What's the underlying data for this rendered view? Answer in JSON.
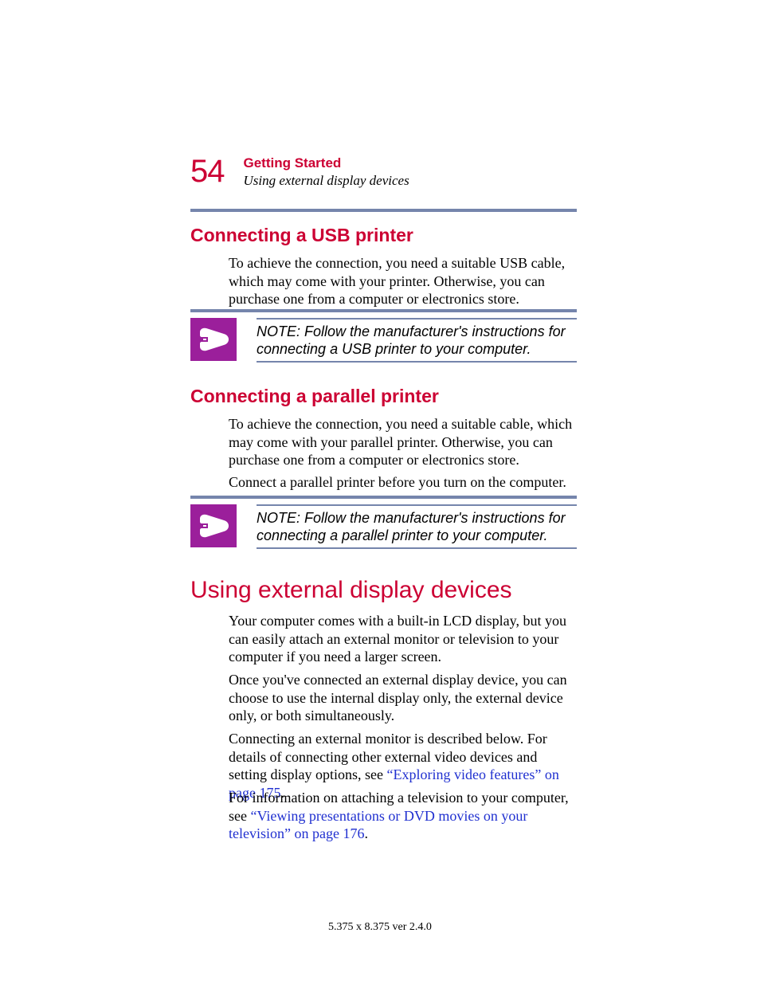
{
  "header": {
    "page_number": "54",
    "chapter": "Getting Started",
    "section": "Using external display devices"
  },
  "sections": {
    "usb": {
      "heading": "Connecting a USB printer",
      "body": "To achieve the connection, you need a suitable USB cable, which may come with your printer. Otherwise, you can purchase one from a computer or electronics store.",
      "note": "NOTE: Follow the manufacturer's instructions for connecting a USB printer to your computer."
    },
    "parallel": {
      "heading": "Connecting a parallel printer",
      "body1": "To achieve the connection, you need a suitable cable, which may come with your parallel printer. Otherwise, you can purchase one from a computer or electronics store.",
      "body2": "Connect a parallel printer before you turn on the computer.",
      "note": "NOTE: Follow the manufacturer's instructions for connecting a parallel printer to your computer."
    },
    "display": {
      "heading": "Using external display devices",
      "p1": "Your computer comes with a built-in LCD display, but you can easily attach an external monitor or television to your computer if you need a larger screen.",
      "p2": "Once you've connected an external display device, you can choose to use the internal display only, the external device only, or both simultaneously.",
      "p3_pre": "Connecting an external monitor is described below. For details of connecting other external video devices and setting display options, see ",
      "p3_link": "“Exploring video features” on page 175",
      "p3_post": ".",
      "p4_pre": "For information on attaching a television to your computer, see ",
      "p4_link": "“Viewing presentations or DVD movies on your television” on page 176",
      "p4_post": "."
    }
  },
  "footer": "5.375 x 8.375 ver 2.4.0"
}
